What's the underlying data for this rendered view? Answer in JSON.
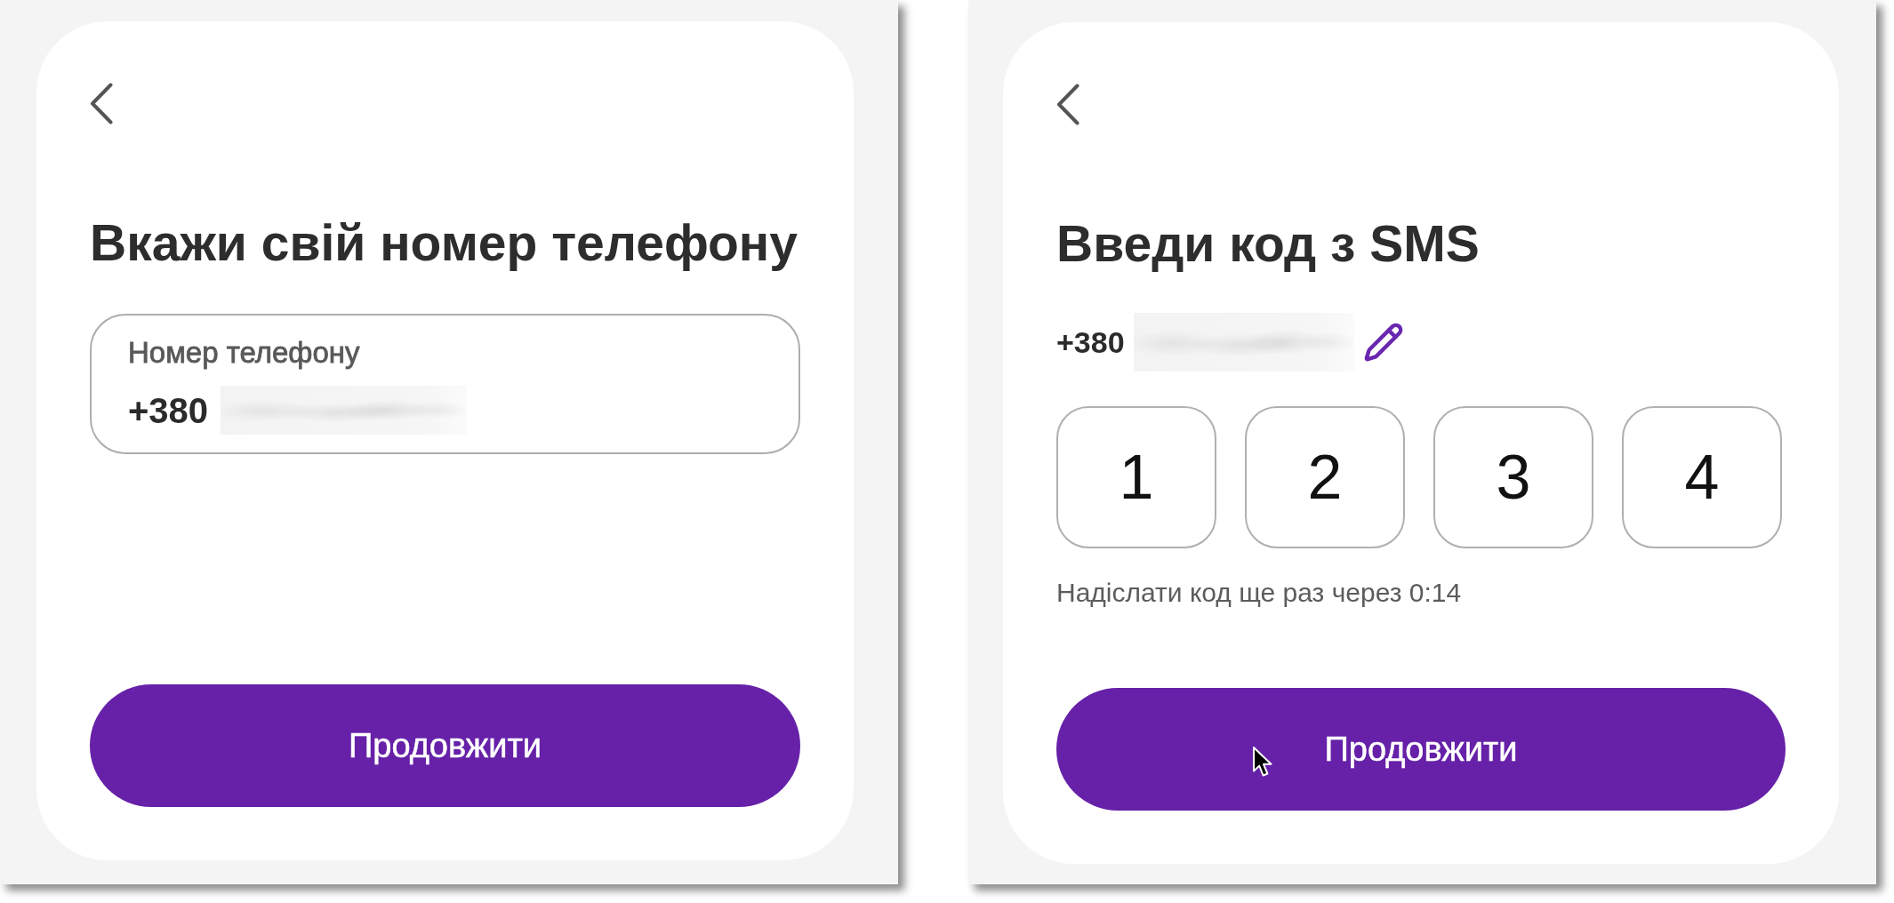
{
  "screens": [
    {
      "kind": "phone",
      "title": "Вкажи свій номер телефону",
      "field": {
        "label": "Номер телефону",
        "value": "+380",
        "blurred": true
      },
      "button": {
        "label": "Продовжити",
        "hovered": false
      }
    },
    {
      "kind": "code",
      "title": "Введи код з SMS",
      "phone": {
        "value": "+380",
        "blurred": true
      },
      "code_digits": [
        "1",
        "2",
        "3",
        "4"
      ],
      "resend_note": "Надіслати код ще раз через 0:14",
      "button": {
        "label": "Продовжити",
        "hovered": true
      }
    }
  ]
}
